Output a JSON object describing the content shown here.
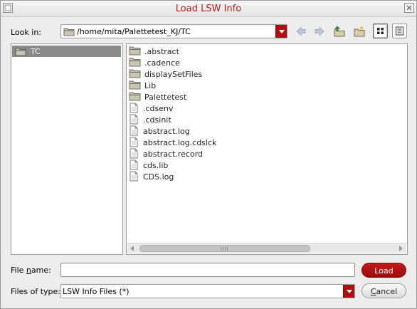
{
  "window": {
    "title": "Load LSW Info"
  },
  "look_in": {
    "label": "Look in:",
    "path": "/home/mita/Palettetest_KJ/TC"
  },
  "toolbar": {
    "icons": [
      "back-icon",
      "forward-icon",
      "parent-directory-icon",
      "new-folder-icon",
      "icon-view-icon",
      "detail-view-icon"
    ]
  },
  "sidebar": {
    "items": [
      {
        "label": "TC",
        "selected": true
      }
    ]
  },
  "files": [
    {
      "name": ".abstract",
      "type": "folder"
    },
    {
      "name": ".cadence",
      "type": "folder"
    },
    {
      "name": "displaySetFiles",
      "type": "folder"
    },
    {
      "name": "Lib",
      "type": "folder"
    },
    {
      "name": "Palettetest",
      "type": "folder"
    },
    {
      "name": ".cdsenv",
      "type": "file"
    },
    {
      "name": ".cdsinit",
      "type": "file"
    },
    {
      "name": "abstract.log",
      "type": "file"
    },
    {
      "name": "abstract.log.cdslck",
      "type": "file"
    },
    {
      "name": "abstract.record",
      "type": "file"
    },
    {
      "name": "cds.lib",
      "type": "file"
    },
    {
      "name": "CDS.log",
      "type": "file"
    }
  ],
  "file_name": {
    "label_pre": "File ",
    "label_underlined": "n",
    "label_post": "ame:",
    "value": ""
  },
  "files_of_type": {
    "label": "Files of type:",
    "value": "LSW Info Files (*)"
  },
  "buttons": {
    "load": "Load",
    "cancel_underlined": "C",
    "cancel_rest": "ancel"
  },
  "colors": {
    "accent": "#b00f0f",
    "title": "#b51b1b",
    "selection": "#8a8a8a"
  }
}
